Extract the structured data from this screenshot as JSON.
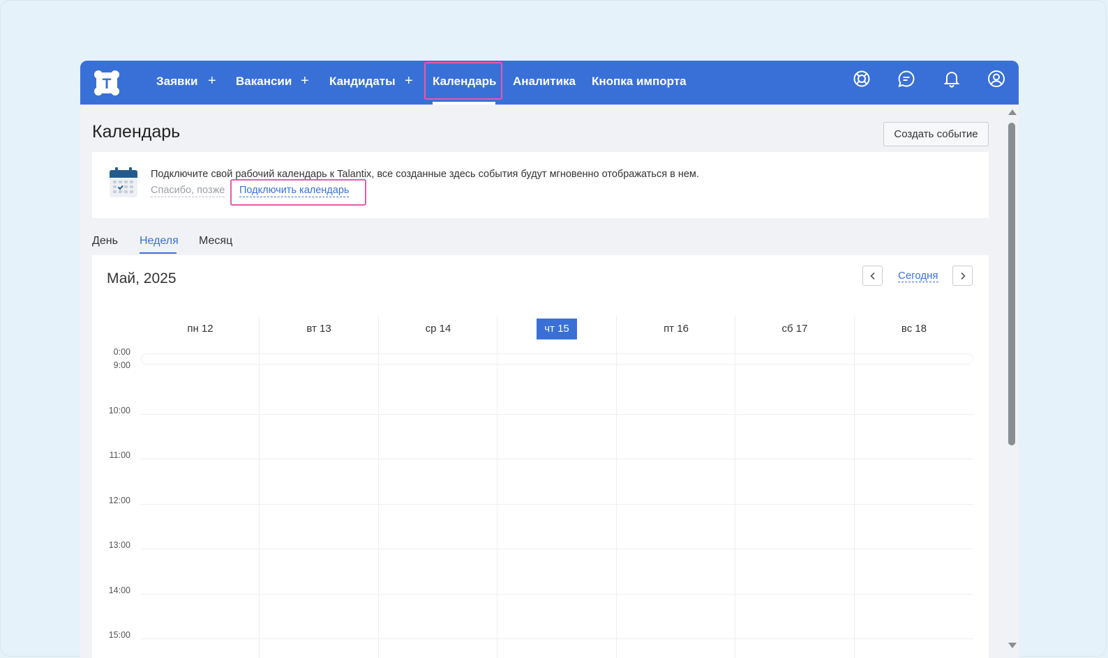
{
  "header": {
    "logo_letter": "T",
    "nav": [
      {
        "label": "Заявки",
        "plus": "+"
      },
      {
        "label": "Вакансии",
        "plus": "+"
      },
      {
        "label": "Кандидаты",
        "plus": "+"
      },
      {
        "label": "Календарь",
        "active": true
      },
      {
        "label": "Аналитика"
      },
      {
        "label": "Кнопка импорта"
      }
    ],
    "icons": [
      "help-lifebuoy-icon",
      "chat-icon",
      "bell-icon",
      "user-icon"
    ],
    "brand_color": "#3970d8",
    "highlight_color": "#e85aa8"
  },
  "page": {
    "title": "Календарь",
    "create_button": "Создать событие"
  },
  "banner": {
    "icon": "calendar-icon",
    "text": "Подключите свой рабочий календарь к Talantix, все созданные здесь события будут мгновенно отображаться в нем.",
    "later_link": "Спасибо, позже",
    "connect_link": "Подключить календарь"
  },
  "view_tabs": [
    {
      "label": "День"
    },
    {
      "label": "Неделя",
      "active": true
    },
    {
      "label": "Месяц"
    }
  ],
  "calendar": {
    "month": "Май, 2025",
    "today_link": "Сегодня",
    "days": [
      "пн 12",
      "вт 13",
      "ср 14",
      "чт 15",
      "пт 16",
      "сб 17",
      "вс 18"
    ],
    "today_index": 3,
    "times": [
      "0:00",
      "9:00",
      "10:00",
      "11:00",
      "12:00",
      "13:00",
      "14:00",
      "15:00"
    ]
  }
}
